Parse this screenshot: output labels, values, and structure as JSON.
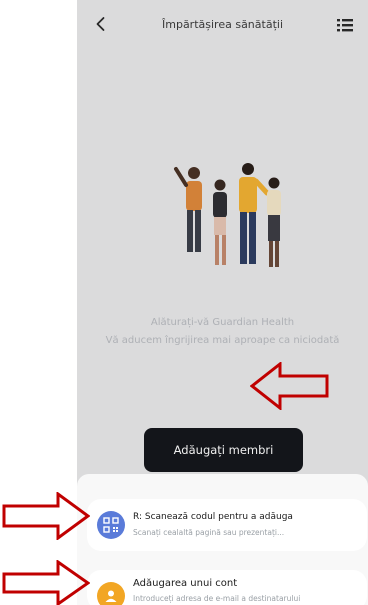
{
  "header": {
    "title": "Împărtășirea sănătății",
    "back_icon": "chevron-left-icon",
    "menu_icon": "list-icon"
  },
  "promo": {
    "line1": "Alăturați-vă Guardian Health",
    "line2": "Vă aducem îngrijirea mai aproape ca niciodată"
  },
  "add_members_label": "Adăugați membri",
  "sheet": {
    "options": [
      {
        "title": "R: Scanează codul pentru a adăuga",
        "subtitle": "Scanați cealaltă pagină sau prezentați...",
        "icon": "qr-code-icon"
      },
      {
        "title": "Adăugarea unui cont",
        "subtitle": "Introduceți adresa de e-mail a destinatarului",
        "icon": "user-icon"
      }
    ]
  },
  "colors": {
    "button_dark": "#15171c",
    "qr_icon_bg": "#5a7bd9",
    "account_icon_bg": "#f2a624",
    "annotation_arrow": "#c00000"
  }
}
